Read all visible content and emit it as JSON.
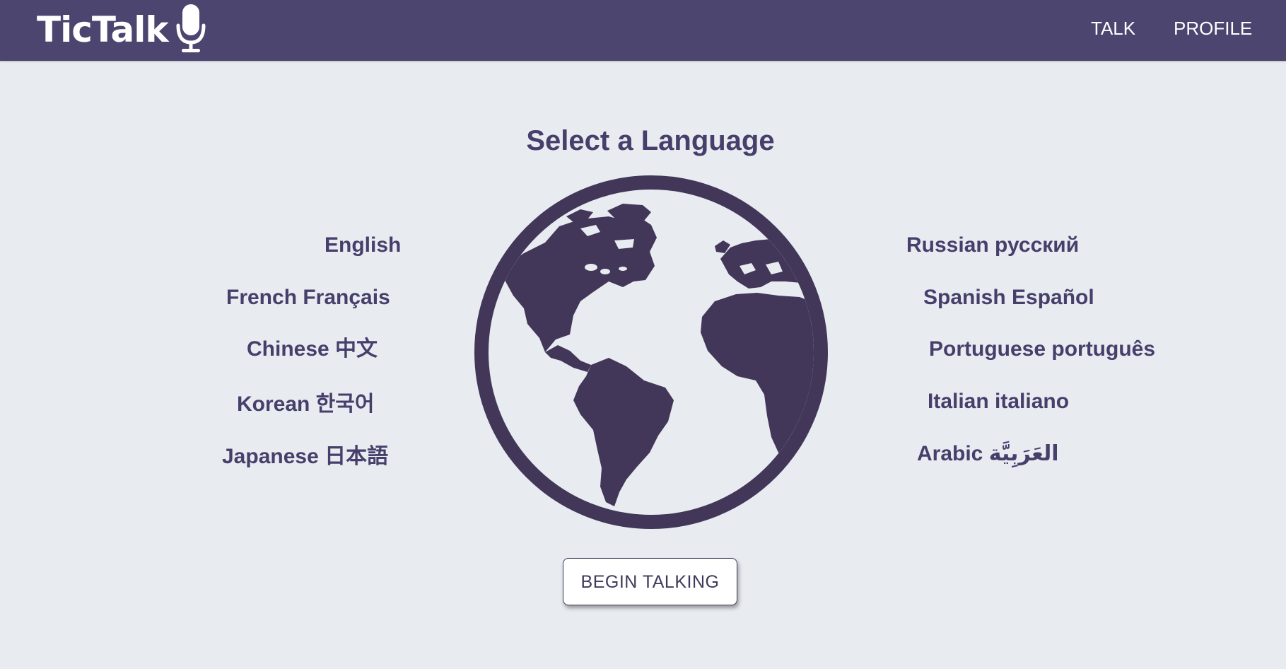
{
  "app": {
    "brand_name": "TicTalk"
  },
  "nav": {
    "talk_label": "TALK",
    "profile_label": "PROFILE"
  },
  "main": {
    "title": "Select a Language",
    "left_languages": [
      {
        "label": "English"
      },
      {
        "label": "French Français"
      },
      {
        "label": "Chinese 中文"
      },
      {
        "label": "Korean 한국어"
      },
      {
        "label": "Japanese 日本語"
      }
    ],
    "right_languages": [
      {
        "label": "Russian русский"
      },
      {
        "label": "Spanish Español"
      },
      {
        "label": "Portuguese português"
      },
      {
        "label": "Italian italiano"
      },
      {
        "label": "Arabic العَرَبِيَّة"
      }
    ],
    "begin_button_label": "BEGIN TALKING"
  },
  "colors": {
    "navbar": "#4c456f",
    "accent_text": "#463f6b",
    "globe": "#423659",
    "background": "#e8ebf0"
  },
  "icons": {
    "brand": "microphone-icon",
    "center": "globe-icon"
  }
}
